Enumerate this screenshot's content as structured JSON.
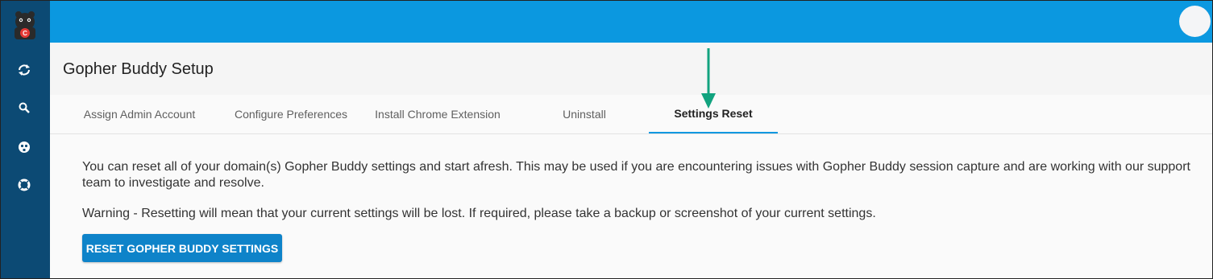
{
  "app": {
    "title": "Gopher Buddy Setup",
    "brand_color": "#0b98e0",
    "sidebar_color": "#0c4a74"
  },
  "sidebar": {
    "logo": "gopher-buddy-logo",
    "items": [
      {
        "icon": "sync-icon"
      },
      {
        "icon": "search-icon"
      },
      {
        "icon": "gopher-icon"
      },
      {
        "icon": "support-icon"
      }
    ]
  },
  "topbar": {
    "avatar_icon": "user-avatar"
  },
  "tabs": [
    {
      "label": "Assign Admin Account",
      "active": false
    },
    {
      "label": "Configure Preferences",
      "active": false
    },
    {
      "label": "Install Chrome Extension",
      "active": false
    },
    {
      "label": "Uninstall",
      "active": false
    },
    {
      "label": "Settings Reset",
      "active": true
    }
  ],
  "content": {
    "description": "You can reset all of your domain(s) Gopher Buddy settings and start afresh. This may be used if you are encountering issues with Gopher Buddy session capture and are working with our support team to investigate and resolve.",
    "warning": "Warning - Resetting will mean that your current settings will be lost. If required, please take a backup or screenshot of your current settings.",
    "reset_button": "RESET GOPHER BUDDY SETTINGS"
  },
  "annotation": {
    "arrow_color": "#12a37f",
    "arrow_target": "Settings Reset"
  }
}
